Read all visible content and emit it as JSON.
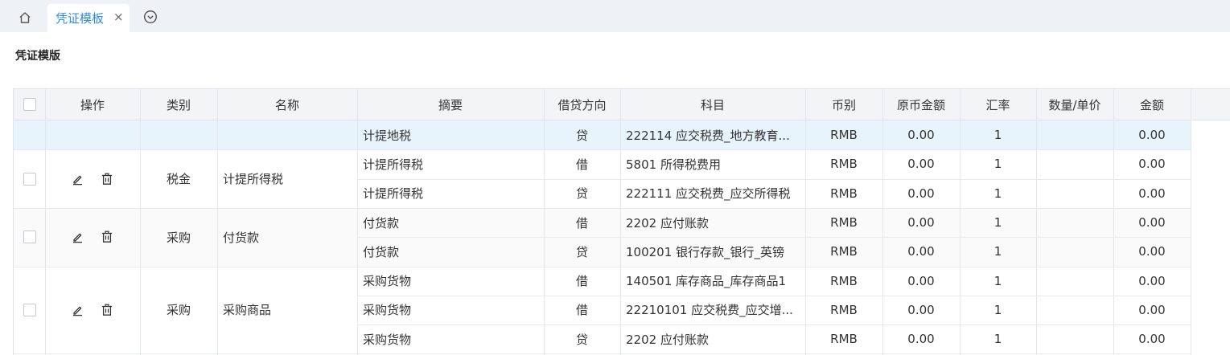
{
  "tabs": {
    "active_label": "凭证模板",
    "close_glyph": "×"
  },
  "page": {
    "title": "凭证模版"
  },
  "table": {
    "headers": {
      "op": "操作",
      "category": "类别",
      "name": "名称",
      "summary": "摘要",
      "direction": "借贷方向",
      "account": "科目",
      "currency": "币别",
      "orig_amount": "原币金额",
      "rate": "汇率",
      "qty_price": "数量/单价",
      "amount": "金额"
    },
    "groups": [
      {
        "category": "",
        "name": ""
      },
      {
        "category": "税金",
        "name": "计提所得税"
      },
      {
        "category": "采购",
        "name": "付货款"
      },
      {
        "category": "采购",
        "name": "采购商品"
      }
    ],
    "rows": [
      {
        "summary": "计提地税",
        "direction": "贷",
        "account": "222114 应交税费_地方教育...",
        "currency": "RMB",
        "orig_amount": "0.00",
        "rate": "1",
        "qty_price": "",
        "amount": "0.00"
      },
      {
        "summary": "计提所得税",
        "direction": "借",
        "account": "5801 所得税费用",
        "currency": "RMB",
        "orig_amount": "0.00",
        "rate": "1",
        "qty_price": "",
        "amount": "0.00"
      },
      {
        "summary": "计提所得税",
        "direction": "贷",
        "account": "222111 应交税费_应交所得税",
        "currency": "RMB",
        "orig_amount": "0.00",
        "rate": "1",
        "qty_price": "",
        "amount": "0.00"
      },
      {
        "summary": "付货款",
        "direction": "借",
        "account": "2202 应付账款",
        "currency": "RMB",
        "orig_amount": "0.00",
        "rate": "1",
        "qty_price": "",
        "amount": "0.00"
      },
      {
        "summary": "付货款",
        "direction": "贷",
        "account": "100201 银行存款_银行_英镑",
        "currency": "RMB",
        "orig_amount": "0.00",
        "rate": "1",
        "qty_price": "",
        "amount": "0.00"
      },
      {
        "summary": "采购货物",
        "direction": "借",
        "account": "140501 库存商品_库存商品1",
        "currency": "RMB",
        "orig_amount": "0.00",
        "rate": "1",
        "qty_price": "",
        "amount": "0.00"
      },
      {
        "summary": "采购货物",
        "direction": "借",
        "account": "22210101 应交税费_应交增...",
        "currency": "RMB",
        "orig_amount": "0.00",
        "rate": "1",
        "qty_price": "",
        "amount": "0.00"
      },
      {
        "summary": "采购货物",
        "direction": "贷",
        "account": "2202 应付账款",
        "currency": "RMB",
        "orig_amount": "0.00",
        "rate": "1",
        "qty_price": "",
        "amount": "0.00"
      }
    ]
  },
  "colors": {
    "accent": "#2e8be8",
    "highlight_row": "#e8f4fc",
    "header_bg": "#f3f4f6",
    "tabbar_bg": "#eef1f5"
  },
  "icons": [
    "home-icon",
    "close-icon",
    "chevron-down-circle-icon",
    "checkbox-icon",
    "edit-icon",
    "delete-icon"
  ]
}
